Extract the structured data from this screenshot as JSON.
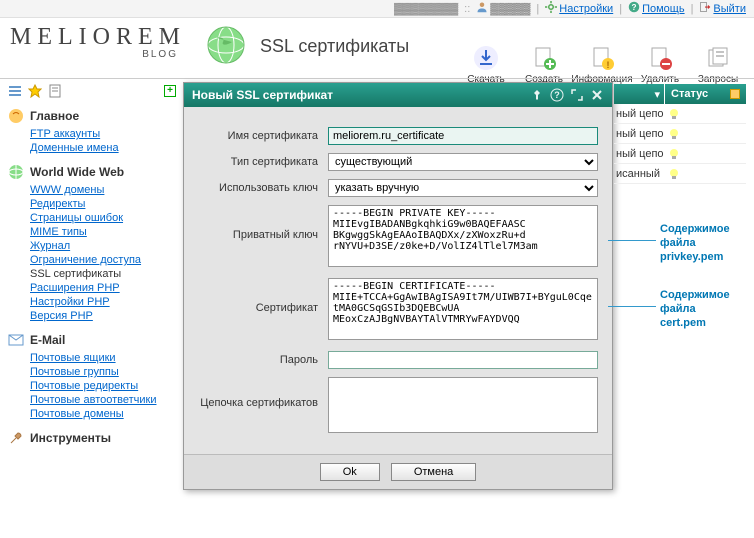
{
  "topbar": {
    "settings": "Настройки",
    "help": "Помощь",
    "logout": "Выйти"
  },
  "logo": {
    "main": "MELIOREM",
    "sub": "BLOG"
  },
  "page_title": "SSL сертификаты",
  "toolbar": {
    "download": "Скачать",
    "create": "Создать",
    "info": "Информация",
    "delete": "Удалить",
    "requests": "Запросы"
  },
  "sidebar": {
    "main": {
      "title": "Главное",
      "items": [
        "FTP аккаунты",
        "Доменные имена"
      ]
    },
    "www": {
      "title": "World Wide Web",
      "items": [
        "WWW домены",
        "Редиректы",
        "Страницы ошибок",
        "MIME типы",
        "Журнал",
        "Ограничение доступа"
      ],
      "plain": "SSL сертификаты",
      "items2": [
        "Расширения PHP",
        "Настройки PHP",
        "Версия PHP"
      ]
    },
    "email": {
      "title": "E-Mail",
      "items": [
        "Почтовые ящики",
        "Почтовые группы",
        "Почтовые редиректы",
        "Почтовые автоответчики",
        "Почтовые домены"
      ]
    },
    "tools": {
      "title": "Инструменты"
    }
  },
  "modal": {
    "title": "Новый SSL сертификат",
    "labels": {
      "name": "Имя сертификата",
      "type": "Тип сертификата",
      "usekey": "Использовать ключ",
      "privkey": "Приватный ключ",
      "cert": "Сертификат",
      "password": "Пароль",
      "chain": "Цепочка сертификатов"
    },
    "values": {
      "name": "meliorem.ru_certificate",
      "type": "существующий",
      "usekey": "указать вручную",
      "privkey": "-----BEGIN PRIVATE KEY-----\nMIIEvgIBADANBgkqhkiG9w0BAQEFAASC\nBKgwggSkAgEAAoIBAQDXx/zXWoxzRu+d\nrNYVU+D3SE/z0ke+D/VolIZ4lTlel7M3am",
      "cert": "-----BEGIN CERTIFICATE-----\nMIIE+TCCA+GgAwIBAgISA9It7M/UIWB7I+BYguL0CqetMA0GCSqGSIb3DQEBCwUA\nMEoxCzAJBgNVBAYTAlVTMRYwFAYDVQQ"
    },
    "buttons": {
      "ok": "Ok",
      "cancel": "Отмена"
    }
  },
  "right": {
    "status_header": "Статус",
    "rows": [
      "ный цепо",
      "ный цепо",
      "ный цепо",
      "исанный"
    ]
  },
  "callouts": {
    "privkey": {
      "l1": "Содержимое",
      "l2": "файла",
      "l3": "privkey.pem"
    },
    "cert": {
      "l1": "Содержимое",
      "l2": "файла",
      "l3": "cert.pem"
    }
  }
}
